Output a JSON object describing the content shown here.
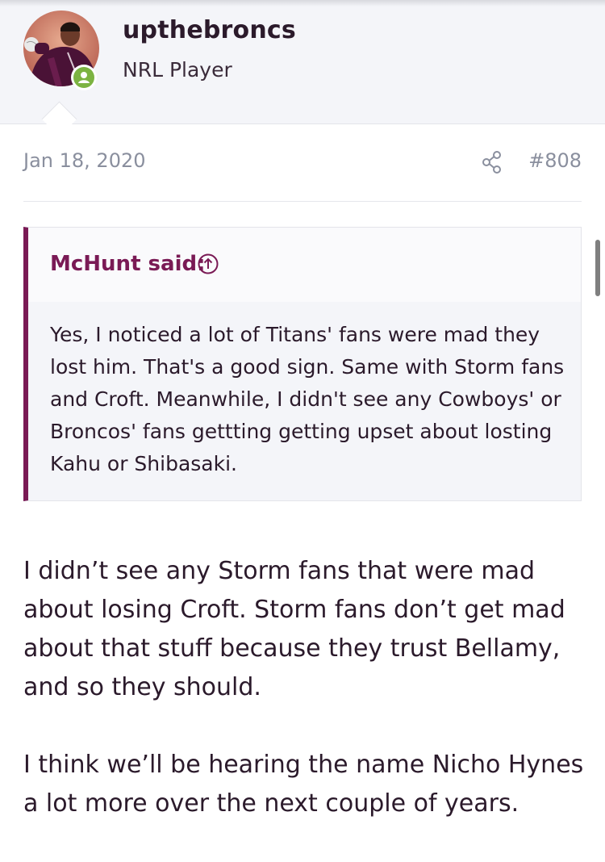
{
  "user": {
    "username": "upthebroncs",
    "title": "NRL Player",
    "status_color": "#7cb342"
  },
  "post": {
    "date": "Jan 18, 2020",
    "number": "#808",
    "share_icon": "share-icon"
  },
  "quote": {
    "author": "McHunt said:",
    "arrow_icon": "arrow-up-circle-icon",
    "text": "Yes, I noticed a lot of Titans' fans were mad they lost him. That's a good sign. Same with Storm fans and Croft. Meanwhile, I didn't see any Cowboys' or Broncos' fans gettting getting upset about losting Kahu or Shibasaki."
  },
  "body": {
    "paragraphs": [
      "I didn’t see any Storm fans that were mad about losing Croft. Storm fans don’t get mad about that stuff because they trust Bellamy, and so they should.",
      "I think we’ll be hearing the name Nicho Hynes a lot more over the next couple of years."
    ]
  },
  "colors": {
    "accent": "#7a1a55",
    "meta_text": "#8a8f9e",
    "header_bg": "#f4f5f9"
  }
}
